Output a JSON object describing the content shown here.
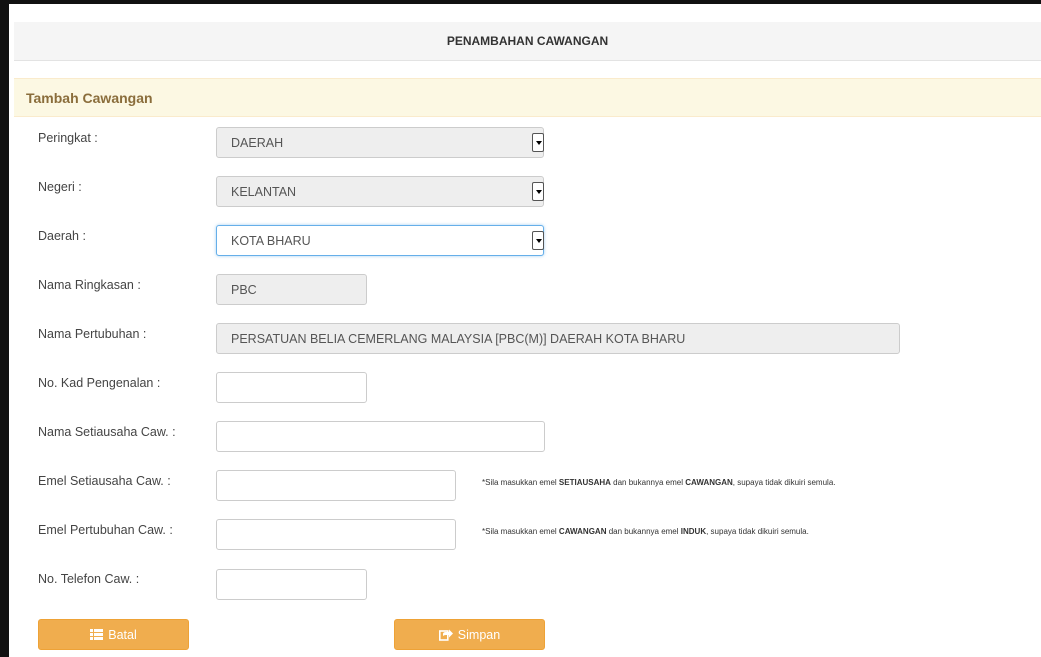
{
  "header": {
    "title": "PENAMBAHAN CAWANGAN"
  },
  "section": {
    "title": "Tambah Cawangan"
  },
  "form": {
    "peringkat": {
      "label": "Peringkat :",
      "value": "DAERAH"
    },
    "negeri": {
      "label": "Negeri :",
      "value": "KELANTAN"
    },
    "daerah": {
      "label": "Daerah :",
      "value": "KOTA BHARU"
    },
    "nama_ringkasan": {
      "label": "Nama Ringkasan :",
      "value": "PBC"
    },
    "nama_pertubuhan": {
      "label": "Nama Pertubuhan :",
      "value": "PERSATUAN BELIA CEMERLANG MALAYSIA [PBC(M)] DAERAH KOTA BHARU"
    },
    "kad_pengenalan": {
      "label": "No. Kad Pengenalan :",
      "value": ""
    },
    "nama_setiausaha": {
      "label": "Nama Setiausaha Caw. :",
      "value": ""
    },
    "emel_setiausaha": {
      "label": "Emel Setiausaha Caw. :",
      "value": "",
      "note_pre": "*Sila masukkan emel ",
      "note_b1": "SETIAUSAHA",
      "note_mid": " dan bukannya emel ",
      "note_b2": "CAWANGAN",
      "note_post": ", supaya tidak dikuiri semula."
    },
    "emel_pertubuhan": {
      "label": "Emel Pertubuhan Caw. :",
      "value": "",
      "note_pre": "*Sila masukkan emel ",
      "note_b1": "CAWANGAN",
      "note_mid": " dan bukannya emel ",
      "note_b2": "INDUK",
      "note_post": ", supaya tidak dikuiri semula."
    },
    "telefon": {
      "label": "No. Telefon Caw. :",
      "value": ""
    }
  },
  "buttons": {
    "batal": {
      "label": "Batal",
      "icon": "list-icon"
    },
    "simpan": {
      "label": "Simpan",
      "icon": "share-icon"
    }
  },
  "colors": {
    "button": "#f0ad4e",
    "section_bg": "#fcf8e3",
    "section_text": "#8a6d3b",
    "focus_border": "#66afe9"
  }
}
